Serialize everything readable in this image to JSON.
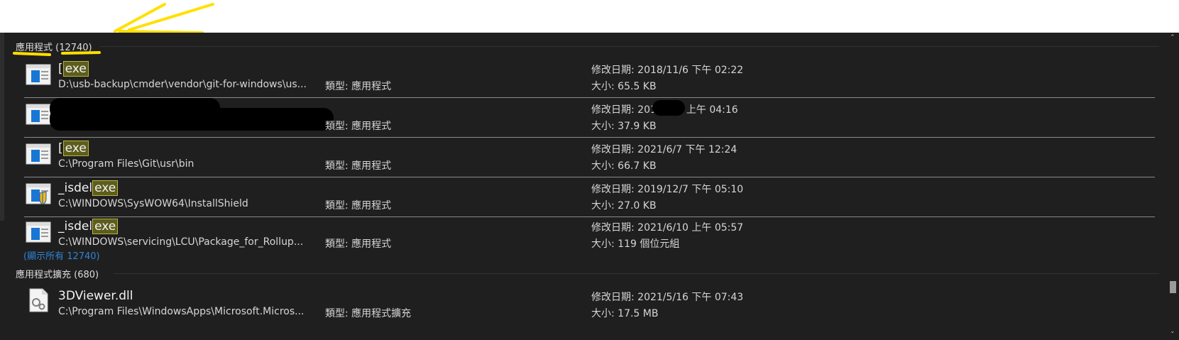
{
  "groups": [
    {
      "header": "應用程式 (12740)",
      "items": [
        {
          "icon": "application-window-icon",
          "name_prefix": "[",
          "name_match": "exe",
          "path": "D:\\usb-backup\\cmder\\vendor\\git-for-windows\\us...",
          "type": "類型: 應用程式",
          "modified": "修改日期: 2018/11/6 下午 02:22",
          "size": "大小: 65.5 KB"
        },
        {
          "icon": "application-window-icon",
          "name_prefix": "",
          "name_match": "",
          "path": "",
          "type": "類型: 應用程式",
          "modified": "修改日期: 201",
          "modified_tail": "上午 04:16",
          "size": "大小: 37.9 KB"
        },
        {
          "icon": "application-window-icon",
          "name_prefix": "[",
          "name_match": "exe",
          "path": "C:\\Program Files\\Git\\usr\\bin",
          "type": "類型: 應用程式",
          "modified": "修改日期: 2021/6/7 下午 12:24",
          "size": "大小: 66.7 KB"
        },
        {
          "icon": "application-shield-icon",
          "name_prefix": "_isdel",
          "name_match": "exe",
          "path": "C:\\WINDOWS\\SysWOW64\\InstallShield",
          "type": "類型: 應用程式",
          "modified": "修改日期: 2019/12/7 下午 05:10",
          "size": "大小: 27.0 KB"
        },
        {
          "icon": "application-window-icon",
          "name_prefix": "_isdel",
          "name_match": "exe",
          "path": "C:\\WINDOWS\\servicing\\LCU\\Package_for_Rollup...",
          "type": "類型: 應用程式",
          "modified": "修改日期: 2021/6/10 上午 05:57",
          "size": "大小: 119 個位元組"
        }
      ],
      "show_all": "(顯示所有 12740)"
    },
    {
      "header": "應用程式擴充 (680)",
      "items": [
        {
          "icon": "dll-gear-icon",
          "name_prefix": "3DViewer.dll",
          "name_match": "",
          "path": "C:\\Program Files\\WindowsApps\\Microsoft.Micros...",
          "type": "類型: 應用程式擴充",
          "modified": "修改日期: 2021/5/16 下午 07:43",
          "size": "大小: 17.5 MB"
        }
      ]
    }
  ],
  "colors": {
    "background": "#1f1f1f",
    "highlight": "#5c5d1e",
    "link": "#2f83d6",
    "annotation": "#ffe000"
  },
  "scrollbar": {
    "up_icon": "chevron-up-icon",
    "down_icon": "chevron-down-icon"
  }
}
